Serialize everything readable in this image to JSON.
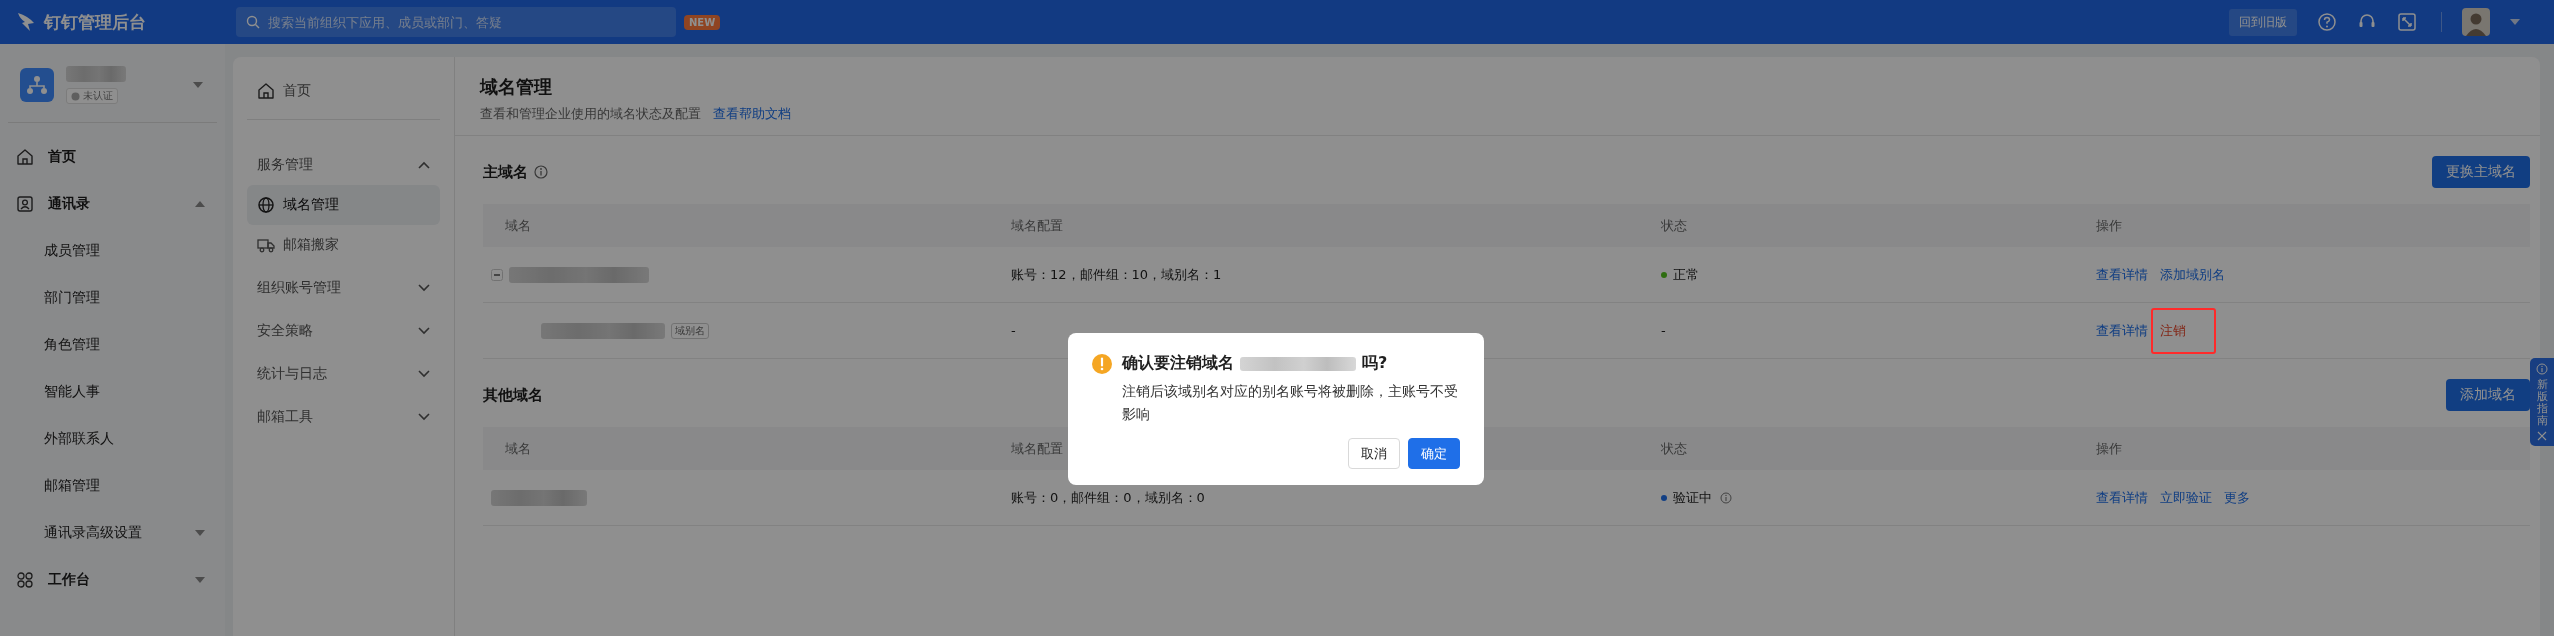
{
  "topbar": {
    "logo": "钉钉管理后台",
    "search": {
      "placeholder": "搜索当前组织下应用、成员或部门、答疑"
    },
    "new_badge": "NEW",
    "old_version_button": "回到旧版"
  },
  "org": {
    "badge": "未认证"
  },
  "sidebar": {
    "items": [
      {
        "kind": "link",
        "label": "首页"
      },
      {
        "kind": "group",
        "label": "通讯录",
        "expanded": true,
        "children": [
          {
            "kind": "link",
            "label": "成员管理"
          },
          {
            "kind": "link",
            "label": "部门管理"
          },
          {
            "kind": "link",
            "label": "角色管理"
          },
          {
            "kind": "link",
            "label": "智能人事"
          },
          {
            "kind": "link",
            "label": "外部联系人"
          },
          {
            "kind": "link",
            "label": "邮箱管理"
          },
          {
            "kind": "group",
            "label": "通讯录高级设置",
            "expanded": false
          }
        ]
      },
      {
        "kind": "group",
        "label": "工作台",
        "expanded": false
      }
    ]
  },
  "subnav": {
    "items": [
      {
        "kind": "link",
        "label": "首页"
      },
      {
        "kind": "group",
        "label": "服务管理",
        "expanded": true,
        "children": [
          {
            "label": "域名管理",
            "selected": true
          },
          {
            "label": "邮箱搬家",
            "selected": false
          }
        ]
      },
      {
        "kind": "group",
        "label": "组织账号管理",
        "expanded": false
      },
      {
        "kind": "group",
        "label": "安全策略",
        "expanded": false
      },
      {
        "kind": "group",
        "label": "统计与日志",
        "expanded": false
      },
      {
        "kind": "group",
        "label": "邮箱工具",
        "expanded": false
      }
    ]
  },
  "page": {
    "title": "域名管理",
    "subtitle": "查看和管理企业使用的域名状态及配置",
    "help_link": "查看帮助文档"
  },
  "sections": [
    {
      "title": "主域名",
      "info_icon": true,
      "button": "更换主域名",
      "columns": [
        "域名",
        "域名配置",
        "状态",
        "操作"
      ],
      "rows": [
        {
          "expanded": true,
          "config": "账号：12，邮件组：10，域别名：1",
          "status": {
            "label": "正常",
            "color": "#2e6d10",
            "info_icon": false
          },
          "actions": [
            {
              "label": "查看详情",
              "kind": "link"
            },
            {
              "label": "添加域别名",
              "kind": "link"
            }
          ],
          "children": [
            {
              "tag": "域别名",
              "config": "-",
              "status": {
                "label": "-",
                "info_icon": false
              },
              "actions": [
                {
                  "label": "查看详情",
                  "kind": "link"
                },
                {
                  "label": "注销",
                  "kind": "danger",
                  "highlighted": true
                }
              ]
            }
          ]
        }
      ]
    },
    {
      "title": "其他域名",
      "info_icon": false,
      "button": "添加域名",
      "columns": [
        "域名",
        "域名配置",
        "状态",
        "操作"
      ],
      "rows": [
        {
          "config": "账号：0，邮件组：0，域别名：0",
          "status": {
            "label": "验证中",
            "color": "#123f84",
            "info_icon": true
          },
          "actions": [
            {
              "label": "查看详情",
              "kind": "link"
            },
            {
              "label": "立即验证",
              "kind": "link"
            },
            {
              "label": "更多",
              "kind": "link"
            }
          ]
        }
      ]
    }
  ],
  "guide": {
    "label": "新版指南"
  },
  "modal": {
    "title_prefix": "确认要注销域名",
    "title_suffix": "吗?",
    "message": "注销后该域别名对应的别名账号将被删除，主账号不受影响",
    "buttons": [
      {
        "label": "取消",
        "kind": "default"
      },
      {
        "label": "确定",
        "kind": "primary"
      }
    ]
  }
}
